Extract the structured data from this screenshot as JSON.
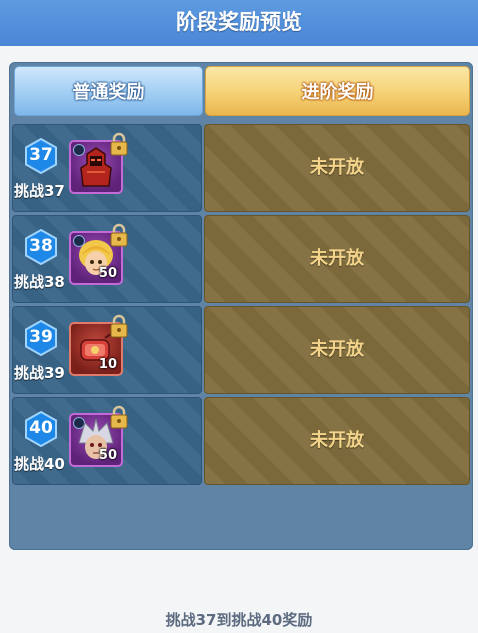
{
  "header": {
    "title": "阶段奖励预览"
  },
  "tabs": {
    "normal_label": "普通奖励",
    "advanced_label": "进阶奖励"
  },
  "rows": [
    {
      "level": "37",
      "challenge": "挑战37",
      "item_icon": "red-armor-icon",
      "quantity": "",
      "status": "未开放"
    },
    {
      "level": "38",
      "challenge": "挑战38",
      "item_icon": "blonde-hero-portrait-icon",
      "quantity": "50",
      "status": "未开放"
    },
    {
      "level": "39",
      "challenge": "挑战39",
      "item_icon": "red-scroll-icon",
      "quantity": "10",
      "status": "未开放"
    },
    {
      "level": "40",
      "challenge": "挑战40",
      "item_icon": "silver-hair-hero-portrait-icon",
      "quantity": "50",
      "status": "未开放"
    }
  ],
  "footer": {
    "text": "挑战37到挑战40奖励"
  },
  "colors": {
    "header": "#4a86d6",
    "panel": "#5f84a6",
    "row_left": "#3a6689",
    "row_right": "#806d3e",
    "status_text": "#f3d48a",
    "hex": "#1e88e8"
  }
}
